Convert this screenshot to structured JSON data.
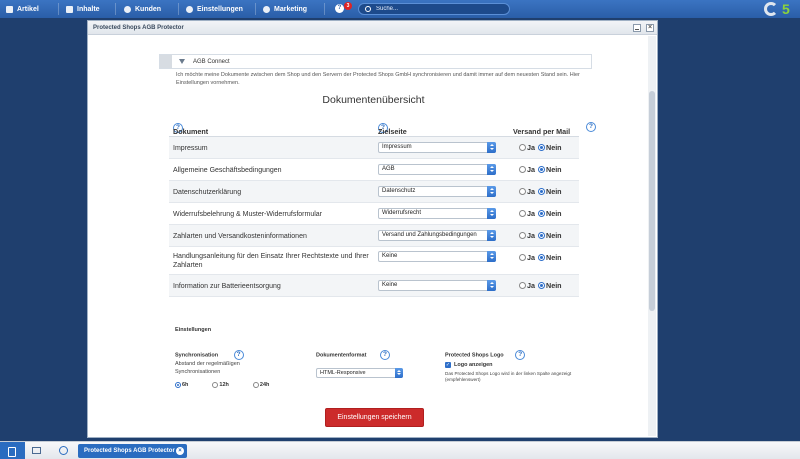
{
  "topnav": {
    "items": [
      {
        "label": "Artikel",
        "icon": "articles-icon"
      },
      {
        "label": "Inhalte",
        "icon": "content-icon"
      },
      {
        "label": "Kunden",
        "icon": "customers-icon"
      },
      {
        "label": "Einstellungen",
        "icon": "settings-icon"
      },
      {
        "label": "Marketing",
        "icon": "marketing-icon"
      }
    ],
    "help_glyph": "?",
    "notification_count": "3",
    "search_placeholder": "Suche...",
    "logo_text": "5"
  },
  "window": {
    "title": "Protected Shops AGB Protector",
    "close_glyph": "×"
  },
  "agb_connect": {
    "label": "AGB Connect",
    "intro": "Ich möchte meine Dokumente zwischen dem Shop und den Servern der Protected Shops GmbH synchronisieren und damit immer auf dem neuesten Stand sein. Hier Einstellungen vornehmen."
  },
  "overview": {
    "title": "Dokumentenübersicht",
    "columns": {
      "document": "Dokument",
      "target": "Zielseite",
      "mail": "Versand per Mail"
    },
    "help_glyph": "?",
    "yes_label": "Ja",
    "no_label": "Nein",
    "rows": [
      {
        "name": "Impressum",
        "target": "Impressum",
        "mail": "no"
      },
      {
        "name": "Allgemeine Geschäftsbedingungen",
        "target": "AGB",
        "mail": "no"
      },
      {
        "name": "Datenschutzerklärung",
        "target": "Datenschutz",
        "mail": "no"
      },
      {
        "name": "Widerrufsbelehrung & Muster-Widerrufsformular",
        "target": "Widerrufsrecht",
        "mail": "no"
      },
      {
        "name": "Zahlarten und Versandkosteninformationen",
        "target": "Versand und Zahlungsbedingungen",
        "mail": "no"
      },
      {
        "name": "Handlungsanleitung für den Einsatz Ihrer Rechtstexte und Ihrer Zahlarten",
        "target": "Keine",
        "mail": "no"
      },
      {
        "name": "Information zur Batterieentsorgung",
        "target": "Keine",
        "mail": "no"
      }
    ]
  },
  "settings": {
    "heading": "Einstellungen",
    "sync": {
      "heading": "Synchronisation",
      "description": "Abstand der regelmäßigen Synchronisationen",
      "options": [
        "6h",
        "12h",
        "24h"
      ],
      "selected": "6h"
    },
    "format": {
      "heading": "Dokumentenformat",
      "value": "HTML-Responsive"
    },
    "logo": {
      "heading": "Protected Shops Logo",
      "checkbox_label": "Logo anzeigen",
      "checked": true,
      "description": "Das Protected Shops Logo wird in der linken Spalte angezeigt (empfehlenswert)"
    },
    "save_label": "Einstellungen speichern"
  },
  "taskbar": {
    "task_label": "Protected Shops AGB Protector",
    "close_glyph": "×"
  },
  "colors": {
    "topbar": "#2a5ea8",
    "accent": "#2a6cc0",
    "save_button": "#cc2b2b",
    "desktop": "#1f3f6e"
  }
}
